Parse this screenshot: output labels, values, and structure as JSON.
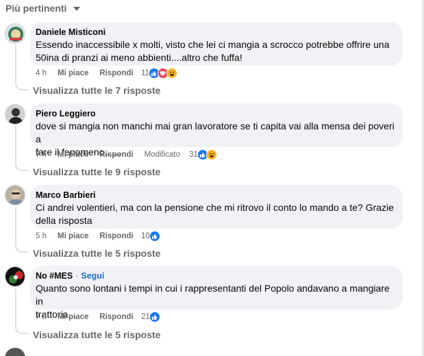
{
  "sort": {
    "label": "Più pertinenti"
  },
  "comments": [
    {
      "author": "Daniele Misticoni",
      "follow": "",
      "text_lines": [
        "Essendo inaccessibile x molti, visto che lei ci mangia a scrocco potrebbe offrire una",
        "50ina di pranzi ai meno abbienti....altro che fuffa!"
      ],
      "time": "4 h",
      "like": "Mi piace",
      "reply": "Rispondi",
      "modified": "",
      "reaction_count": "11",
      "reactions": [
        "like-icon",
        "love-icon",
        "haha-icon"
      ],
      "replies": "Visualizza tutte le 7 risposte"
    },
    {
      "author": "Piero Leggiero",
      "follow": "",
      "text_lines": [
        "dove si mangia non manchi mai gran lavoratore se ti capita vai alla mensa dei poveri a",
        "fare il fenomeno......"
      ],
      "time": "7 h",
      "like": "Mi piace",
      "reply": "Rispondi",
      "modified": "Modificato",
      "reaction_count": "31",
      "reactions": [
        "like-icon",
        "haha-icon"
      ],
      "replies": "Visualizza tutte le 9 risposte"
    },
    {
      "author": "Marco Barbieri",
      "follow": "",
      "text_lines": [
        "Ci andrei volentieri, ma con la pensione che mi ritrovo il conto lo mando a te? Grazie",
        "della risposta"
      ],
      "time": "5 h",
      "like": "Mi piace",
      "reply": "Rispondi",
      "modified": "",
      "reaction_count": "10",
      "reactions": [
        "like-icon"
      ],
      "replies": "Visualizza tutte le 5 risposte"
    },
    {
      "author": "No #MES",
      "follow": "Segui",
      "text_lines": [
        "Quanto sono lontani i tempi in cui i rappresentanti del Popolo andavano a mangiare in",
        "trattoria..."
      ],
      "time": "7 h",
      "like": "Mi piace",
      "reply": "Rispondi",
      "modified": "",
      "reaction_count": "21",
      "reactions": [
        "like-icon"
      ],
      "replies": "Visualizza tutte le 5 risposte"
    }
  ],
  "colors": {
    "like": "#1877f2",
    "love": "#f33e58",
    "haha": "#f7b125",
    "link": "#216fdb"
  }
}
